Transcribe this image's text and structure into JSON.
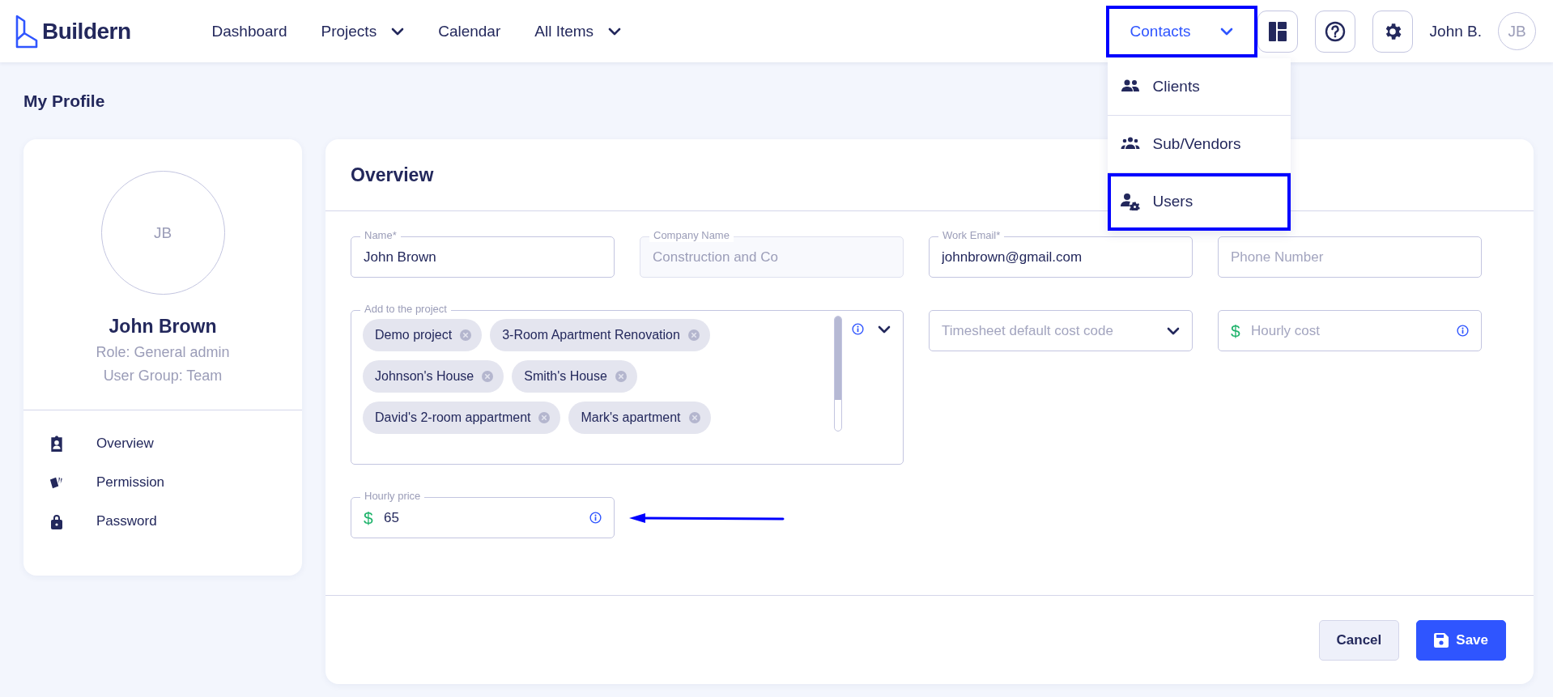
{
  "header": {
    "logo": "Buildern",
    "nav": [
      {
        "label": "Dashboard",
        "dropdown": false
      },
      {
        "label": "Projects",
        "dropdown": true
      },
      {
        "label": "Calendar",
        "dropdown": false
      },
      {
        "label": "All Items",
        "dropdown": true
      }
    ],
    "contacts": {
      "label": "Contacts",
      "highlighted": true
    },
    "user_name": "John B.",
    "avatar": "JB"
  },
  "contacts_menu": [
    {
      "label": "Clients",
      "highlighted": false
    },
    {
      "label": "Sub/Vendors",
      "highlighted": false
    },
    {
      "label": "Users",
      "highlighted": true
    }
  ],
  "page_title": "My Profile",
  "profile": {
    "avatar": "JB",
    "name": "John Brown",
    "role": "Role: General admin",
    "group": "User Group: Team",
    "menu": [
      {
        "label": "Overview"
      },
      {
        "label": "Permission"
      },
      {
        "label": "Password"
      }
    ]
  },
  "overview": {
    "title": "Overview",
    "fields": [
      {
        "kind": "text",
        "label": "Name*",
        "value": "John Brown",
        "disabled": false
      },
      {
        "kind": "text",
        "label": "Company Name",
        "value": "Construction and Co",
        "disabled": true
      },
      {
        "kind": "text",
        "label": "Work Email*",
        "value": "johnbrown@gmail.com",
        "disabled": false
      },
      {
        "kind": "text",
        "placeholder": "Phone Number",
        "disabled": false
      },
      {
        "kind": "tags",
        "label": "Add to the project",
        "tags": [
          "Demo project",
          "3-Room Apartment Renovation",
          "Johnson's House",
          "Smith's House",
          "David's 2-room appartment",
          "Mark's apartment"
        ]
      },
      {
        "kind": "select",
        "placeholder": "Timesheet default cost code"
      },
      {
        "kind": "money",
        "prefix": "$",
        "placeholder": "Hourly cost"
      },
      {
        "kind": "money",
        "prefix": "$",
        "label": "Hourly price",
        "value": "65",
        "pointed": true
      }
    ],
    "buttons": [
      {
        "label": "Cancel",
        "kind": "secondary"
      },
      {
        "label": "Save",
        "kind": "primary"
      }
    ]
  }
}
